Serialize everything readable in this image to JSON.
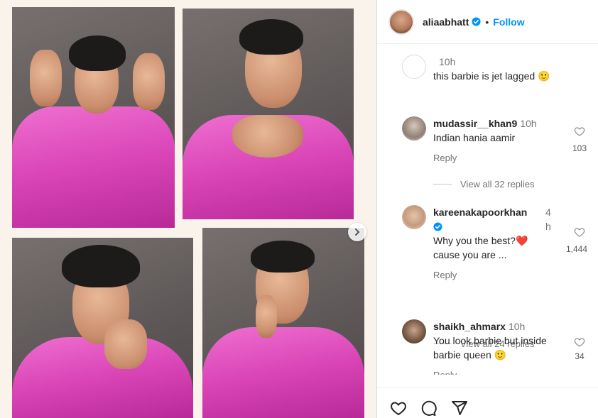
{
  "post": {
    "username": "aliaabhatt",
    "follow_label": "Follow",
    "separator": "•"
  },
  "comments": [
    {
      "username": "",
      "time": "10h",
      "text": "this barbie is jet lagged 🙂",
      "likes": ""
    },
    {
      "username": "mudassir__khan9",
      "time": "10h",
      "text": "Indian hania aamir",
      "reply_label": "Reply",
      "likes": "103",
      "view_replies": "View all 32 replies"
    },
    {
      "username": "kareenakapoorkhan",
      "time": "4h",
      "text": "Why you the best?❤️ cause you are ...",
      "reply_label": "Reply",
      "likes": "1,444",
      "view_replies": "View all 24 replies"
    },
    {
      "username": "shaikh_ahmarx",
      "time": "10h",
      "text": "You look barbie but inside barbie queen 🙂",
      "reply_label": "Reply",
      "likes": "34"
    }
  ],
  "icons": {
    "verified": "verified-badge-icon",
    "heart": "heart-icon",
    "comment": "comment-icon",
    "share": "share-icon",
    "next": "chevron-right-icon"
  },
  "colors": {
    "accent": "#0095f6",
    "suit": "#e254c0"
  }
}
